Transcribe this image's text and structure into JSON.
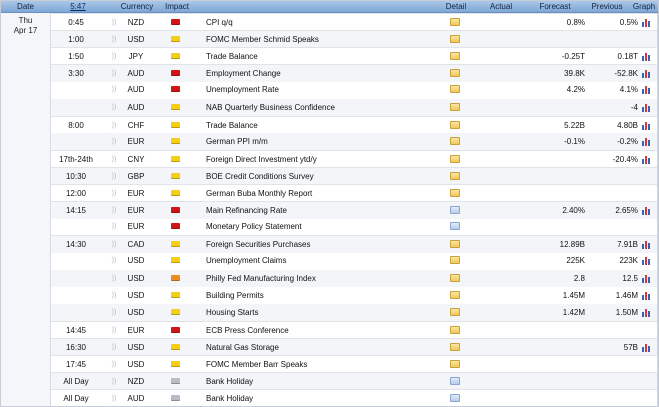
{
  "header": {
    "date": "Date",
    "time": "5:47",
    "currency": "Currency",
    "impact": "Impact",
    "detail": "Detail",
    "actual": "Actual",
    "forecast": "Forecast",
    "previous": "Previous",
    "graph": "Graph"
  },
  "day": {
    "weekday": "Thu",
    "date": "Apr 17"
  },
  "speaker_glyph": "))",
  "colors": {
    "high": "#d21414",
    "medium": "#f4cf16",
    "low": "#f08a24",
    "holiday": "#b8bcc4",
    "header": "#8db2de"
  },
  "events": [
    {
      "time": "0:45",
      "currency": "NZD",
      "impact": "high",
      "event": "CPI q/q",
      "actual": "",
      "forecast": "0.8%",
      "previous": "0.5%",
      "graph": true
    },
    {
      "time": "1:00",
      "currency": "USD",
      "impact": "med",
      "event": "FOMC Member Schmid Speaks",
      "actual": "",
      "forecast": "",
      "previous": "",
      "graph": false
    },
    {
      "time": "1:50",
      "currency": "JPY",
      "impact": "med",
      "event": "Trade Balance",
      "actual": "",
      "forecast": "-0.25T",
      "previous": "0.18T",
      "graph": true
    },
    {
      "time": "3:30",
      "currency": "AUD",
      "impact": "high",
      "event": "Employment Change",
      "actual": "",
      "forecast": "39.8K",
      "previous": "-52.8K",
      "graph": true
    },
    {
      "time": "",
      "currency": "AUD",
      "impact": "high",
      "event": "Unemployment Rate",
      "actual": "",
      "forecast": "4.2%",
      "previous": "4.1%",
      "graph": true
    },
    {
      "time": "",
      "currency": "AUD",
      "impact": "med",
      "event": "NAB Quarterly Business Confidence",
      "actual": "",
      "forecast": "",
      "previous": "-4",
      "graph": true
    },
    {
      "time": "8:00",
      "currency": "CHF",
      "impact": "med",
      "event": "Trade Balance",
      "actual": "",
      "forecast": "5.22B",
      "previous": "4.80B",
      "graph": true
    },
    {
      "time": "",
      "currency": "EUR",
      "impact": "med",
      "event": "German PPI m/m",
      "actual": "",
      "forecast": "-0.1%",
      "previous": "-0.2%",
      "graph": true
    },
    {
      "time": "17th-24th",
      "currency": "CNY",
      "impact": "med",
      "event": "Foreign Direct Investment ytd/y",
      "actual": "",
      "forecast": "",
      "previous": "-20.4%",
      "graph": true
    },
    {
      "time": "10:30",
      "currency": "GBP",
      "impact": "med",
      "event": "BOE Credit Conditions Survey",
      "actual": "",
      "forecast": "",
      "previous": "",
      "graph": false
    },
    {
      "time": "12:00",
      "currency": "EUR",
      "impact": "med",
      "event": "German Buba Monthly Report",
      "actual": "",
      "forecast": "",
      "previous": "",
      "graph": false
    },
    {
      "time": "14:15",
      "currency": "EUR",
      "impact": "high",
      "event": "Main Refinancing Rate",
      "actual": "",
      "forecast": "2.40%",
      "previous": "2.65%",
      "graph": true,
      "detail_style": "exp"
    },
    {
      "time": "",
      "currency": "EUR",
      "impact": "high",
      "event": "Monetary Policy Statement",
      "actual": "",
      "forecast": "",
      "previous": "",
      "graph": false,
      "detail_style": "exp"
    },
    {
      "time": "14:30",
      "currency": "CAD",
      "impact": "med",
      "event": "Foreign Securities Purchases",
      "actual": "",
      "forecast": "12.89B",
      "previous": "7.91B",
      "graph": true
    },
    {
      "time": "",
      "currency": "USD",
      "impact": "med",
      "event": "Unemployment Claims",
      "actual": "",
      "forecast": "225K",
      "previous": "223K",
      "graph": true
    },
    {
      "time": "",
      "currency": "USD",
      "impact": "low",
      "event": "Philly Fed Manufacturing Index",
      "actual": "",
      "forecast": "2.8",
      "previous": "12.5",
      "graph": true
    },
    {
      "time": "",
      "currency": "USD",
      "impact": "med",
      "event": "Building Permits",
      "actual": "",
      "forecast": "1.45M",
      "previous": "1.46M",
      "graph": true
    },
    {
      "time": "",
      "currency": "USD",
      "impact": "med",
      "event": "Housing Starts",
      "actual": "",
      "forecast": "1.42M",
      "previous": "1.50M",
      "graph": true
    },
    {
      "time": "14:45",
      "currency": "EUR",
      "impact": "high",
      "event": "ECB Press Conference",
      "actual": "",
      "forecast": "",
      "previous": "",
      "graph": false
    },
    {
      "time": "16:30",
      "currency": "USD",
      "impact": "med",
      "event": "Natural Gas Storage",
      "actual": "",
      "forecast": "",
      "previous": "57B",
      "graph": true
    },
    {
      "time": "17:45",
      "currency": "USD",
      "impact": "med",
      "event": "FOMC Member Barr Speaks",
      "actual": "",
      "forecast": "",
      "previous": "",
      "graph": false
    },
    {
      "time": "All Day",
      "currency": "NZD",
      "impact": "hol",
      "event": "Bank Holiday",
      "actual": "",
      "forecast": "",
      "previous": "",
      "graph": false,
      "detail_style": "exp"
    },
    {
      "time": "All Day",
      "currency": "AUD",
      "impact": "hol",
      "event": "Bank Holiday",
      "actual": "",
      "forecast": "",
      "previous": "",
      "graph": false,
      "detail_style": "exp"
    }
  ]
}
